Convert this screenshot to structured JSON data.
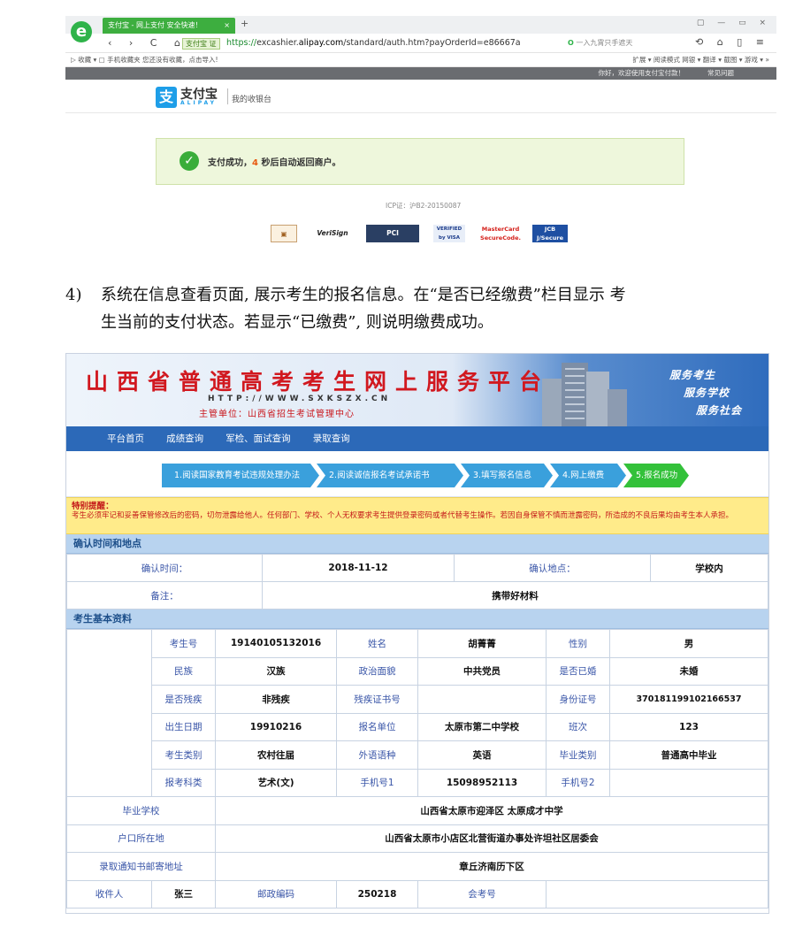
{
  "browser": {
    "logo": "e",
    "tab_title": "支付宝 - 网上支付 安全快速！",
    "tab_close": "×",
    "new_tab": "+",
    "window_controls": "▢ — ▭ ×",
    "nav_buttons": "‹ › C ⌂",
    "pay_badge": "支付宝 证",
    "url_scheme": "https://",
    "url_pre": "excashier.",
    "url_host": "alipay.com",
    "url_path": "/standard/auth.htm?payOrderId=e86667a",
    "search_text": "一入九霄只手遮天",
    "right_icons": "⟲ ⌂ ▯ ≡",
    "bookmarks": "▷ 收藏 ▾  ▢ 手机收藏夹  您还没有收藏，点击导入!",
    "tools": "扩展 ▾  阅读模式  网银 ▾  翻译 ▾  截图 ▾  游戏 ▾  »"
  },
  "alipay": {
    "greeting": "你好，欢迎使用支付宝付款！",
    "faq": "常见问题",
    "logo_char": "支",
    "brand": "支付宝",
    "brand_en": "ALIPAY",
    "desk": "我的收银台",
    "success_pre": "支付成功，",
    "success_num": "4",
    "success_post": " 秒后自动返回商户。",
    "icp": "ICP证：沪B2-20150087",
    "certs": [
      "VeriSign",
      "PCI",
      "VERIFIED by VISA",
      "MasterCard SecureCode.",
      "JCB J/Secure"
    ]
  },
  "paragraph": {
    "number": "4)",
    "line1": "系统在信息查看页面, 展示考生的报名信息。在“是否已经缴费”栏目显示 考",
    "line2": "生当前的支付状态。若显示“已缴费”, 则说明缴费成功。"
  },
  "portal": {
    "title": "山西省普通高考考生网上服务平台",
    "url": "HTTP://WWW.SXKSZX.CN",
    "org": "主管单位：山西省招生考试管理中心",
    "slogans": [
      "服务考生",
      "服务学校",
      "服务社会"
    ],
    "nav": [
      "平台首页",
      "成绩查询",
      "军检、面试查询",
      "录取查询"
    ],
    "steps": [
      "1.阅读国家教育考试违规处理办法",
      "2.阅读诚信报名考试承诺书",
      "3.填写报名信息",
      "4.网上缴费",
      "5.报名成功"
    ],
    "notice_title": "特别提醒：",
    "notice_text": "考生必须牢记和妥善保管修改后的密码，切勿泄露给他人。任何部门、学校、个人无权要求考生提供登录密码或者代替考生操作。若因自身保管不慎而泄露密码，所造成的不良后果均由考生本人承担。",
    "sec1": "确认时间和地点",
    "confirm": {
      "time_label": "确认时间：",
      "time": "2018-11-12",
      "place_label": "确认地点：",
      "place": "学校内",
      "note_label": "备注：",
      "note": "携带好材料"
    },
    "sec2": "考生基本资料",
    "info": {
      "exam_no_label": "考生号",
      "exam_no": "19140105132016",
      "name_label": "姓名",
      "name": "胡菁菁",
      "sex_label": "性别",
      "sex": "男",
      "nation_label": "民族",
      "nation": "汉族",
      "politics_label": "政治面貌",
      "politics": "中共党员",
      "married_label": "是否已婚",
      "married": "未婚",
      "disabled_label": "是否残疾",
      "disabled": "非残疾",
      "disab_cert_label": "残疾证书号",
      "disab_cert": "",
      "id_label": "身份证号",
      "id": "370181199102166537",
      "birth_label": "出生日期",
      "birth": "19910216",
      "unit_label": "报名单位",
      "unit": "太原市第二中学校",
      "class_label": "班次",
      "class": "123",
      "type_label": "考生类别",
      "type": "农村往届",
      "lang_label": "外语语种",
      "lang": "英语",
      "grad_type_label": "毕业类别",
      "grad_type": "普通高中毕业",
      "subject_label": "报考科类",
      "subject": "艺术(文)",
      "phone1_label": "手机号1",
      "phone1": "15098952113",
      "phone2_label": "手机号2",
      "phone2": "",
      "school_label": "毕业学校",
      "school": "山西省太原市迎泽区 太原成才中学",
      "hukou_label": "户口所在地",
      "hukou": "山西省太原市小店区北营街道办事处许坦社区居委会",
      "mail_label": "录取通知书邮寄地址",
      "mail": "章丘济南历下区",
      "recv_label": "收件人",
      "recv": "张三",
      "zip_label": "邮政编码",
      "zip": "250218",
      "huikao_label": "会考号",
      "huikao": ""
    }
  }
}
